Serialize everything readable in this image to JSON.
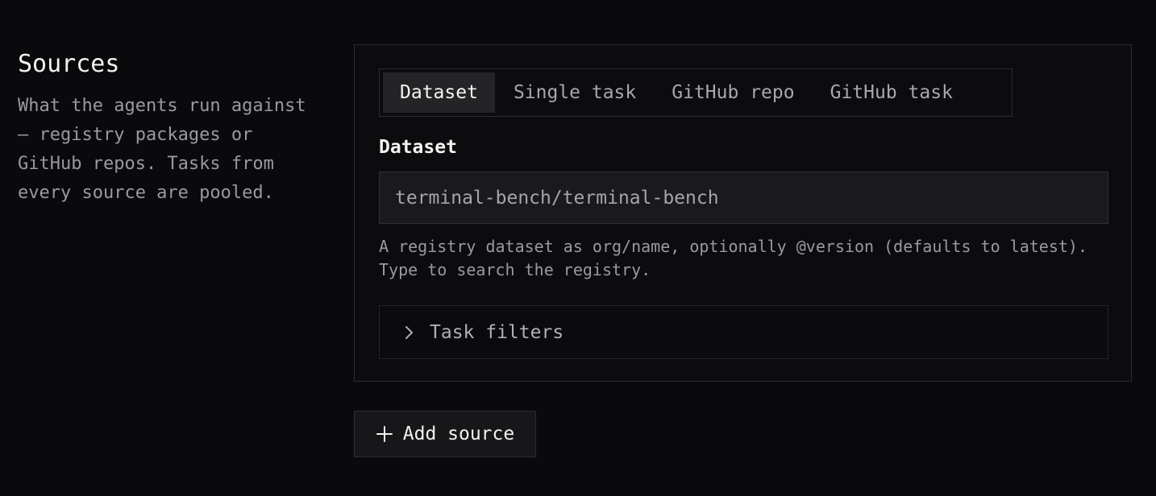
{
  "sources_section": {
    "title": "Sources",
    "description": "What the agents run against — registry packages or GitHub repos. Tasks from every source are pooled."
  },
  "source_card": {
    "tabs": [
      {
        "label": "Dataset",
        "active": true
      },
      {
        "label": "Single task",
        "active": false
      },
      {
        "label": "GitHub repo",
        "active": false
      },
      {
        "label": "GitHub task",
        "active": false
      }
    ],
    "dataset_field": {
      "label": "Dataset",
      "value": "terminal-bench/terminal-bench",
      "help": "A registry dataset as org/name, optionally @version (defaults to latest). Type to search the registry."
    },
    "task_filters": {
      "label": "Task filters",
      "icon": "chevron-right-icon"
    }
  },
  "add_source": {
    "label": "Add source",
    "icon": "plus-icon"
  },
  "colors": {
    "background": "#0a0a0c",
    "active_tab": "#242427",
    "input_bg": "#1a1a1d",
    "border": "#2c2c30"
  }
}
